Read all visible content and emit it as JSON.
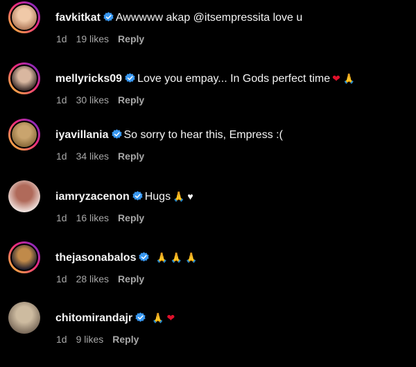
{
  "colors": {
    "background": "#000000",
    "verified": "#3897f0",
    "heart": "#e0112b",
    "meta": "#a8a8a8"
  },
  "comments": [
    {
      "username": "favkitkat",
      "text": "Awwwww akap @itsempressita love u",
      "emojis": "",
      "time": "1d",
      "likes": "19 likes",
      "reply": "Reply",
      "avatar_ring": true,
      "avatar_colors": [
        "#b07a5a",
        "#f0c9a8"
      ]
    },
    {
      "username": "mellyricks09",
      "text": "Love you empay... In Gods perfect time",
      "emojis": "❤ 🙏",
      "time": "1d",
      "likes": "30 likes",
      "reply": "Reply",
      "avatar_ring": true,
      "avatar_colors": [
        "#3a2a28",
        "#d9b7a0"
      ]
    },
    {
      "username": "iyavillania",
      "text": "So sorry to hear this, Empress :(",
      "emojis": "",
      "time": "1d",
      "likes": "34 likes",
      "reply": "Reply",
      "avatar_ring": true,
      "avatar_colors": [
        "#8a6a3a",
        "#c9a46e"
      ]
    },
    {
      "username": "iamryzacenon",
      "text": "Hugs",
      "emojis": "🙏 ♥",
      "time": "1d",
      "likes": "16 likes",
      "reply": "Reply",
      "avatar_ring": false,
      "avatar_colors": [
        "#f2e6e2",
        "#b06a5a"
      ]
    },
    {
      "username": "thejasonabalos",
      "text": "",
      "emojis": "🙏 🙏 🙏",
      "time": "1d",
      "likes": "28 likes",
      "reply": "Reply",
      "avatar_ring": true,
      "avatar_colors": [
        "#1c1c2c",
        "#c08a4a"
      ]
    },
    {
      "username": "chitomirandajr",
      "text": "",
      "emojis": "🙏 ❤",
      "time": "1d",
      "likes": "9 likes",
      "reply": "Reply",
      "avatar_ring": false,
      "avatar_colors": [
        "#7a6a5a",
        "#cdbba0"
      ]
    }
  ]
}
